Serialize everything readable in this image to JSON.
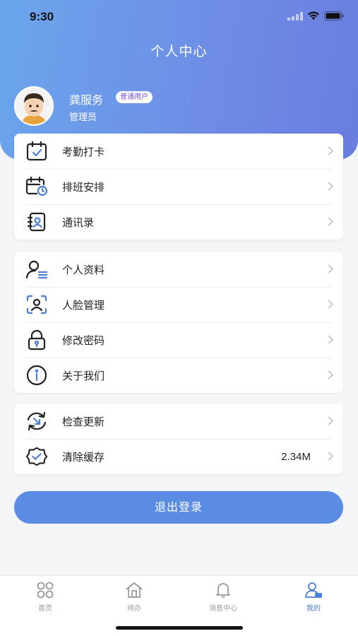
{
  "status_bar": {
    "time": "9:30"
  },
  "header": {
    "title": "个人中心"
  },
  "profile": {
    "name": "龚服务",
    "badge": "普通用户",
    "role": "管理员"
  },
  "group1": [
    {
      "label": "考勤打卡",
      "icon": "attendance-icon"
    },
    {
      "label": "排班安排",
      "icon": "schedule-icon"
    },
    {
      "label": "通讯录",
      "icon": "contacts-icon"
    }
  ],
  "group2": [
    {
      "label": "个人资料",
      "icon": "profile-icon"
    },
    {
      "label": "人脸管理",
      "icon": "face-icon"
    },
    {
      "label": "修改密码",
      "icon": "lock-icon"
    },
    {
      "label": "关于我们",
      "icon": "info-icon"
    }
  ],
  "group3": [
    {
      "label": "检查更新",
      "icon": "refresh-icon"
    },
    {
      "label": "清除缓存",
      "icon": "clear-cache-icon",
      "value": "2.34M"
    }
  ],
  "logout_label": "退出登录",
  "tabs": [
    {
      "label": "首页",
      "icon": "home-grid-icon"
    },
    {
      "label": "待办",
      "icon": "todo-house-icon"
    },
    {
      "label": "消息中心",
      "icon": "bell-icon"
    },
    {
      "label": "我的",
      "icon": "user-icon"
    }
  ],
  "colors": {
    "accent": "#5b8ce3",
    "active_tab": "#4a7fd8",
    "inactive_tab": "#999999"
  }
}
